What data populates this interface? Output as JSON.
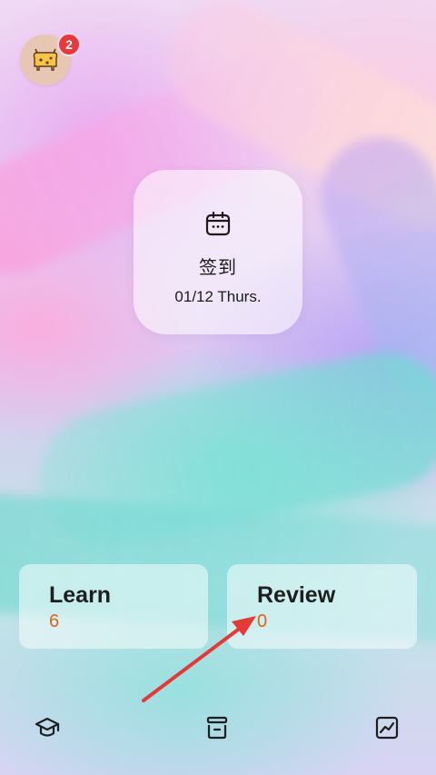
{
  "profile": {
    "avatar_icon": "cow-icon",
    "notification_count": "2"
  },
  "checkin": {
    "icon": "calendar-icon",
    "title": "签到",
    "date": "01/12 Thurs."
  },
  "cards": {
    "learn": {
      "label": "Learn",
      "count": "6"
    },
    "review": {
      "label": "Review",
      "count": "0"
    }
  },
  "annotation": {
    "arrow_color": "#e53935",
    "points_to": "review-count"
  },
  "bottom_nav": [
    {
      "icon": "graduation-cap-icon"
    },
    {
      "icon": "archive-box-icon"
    },
    {
      "icon": "trend-chart-icon"
    }
  ],
  "colors": {
    "accent_count": "#e0621b",
    "badge": "#e5393b"
  }
}
